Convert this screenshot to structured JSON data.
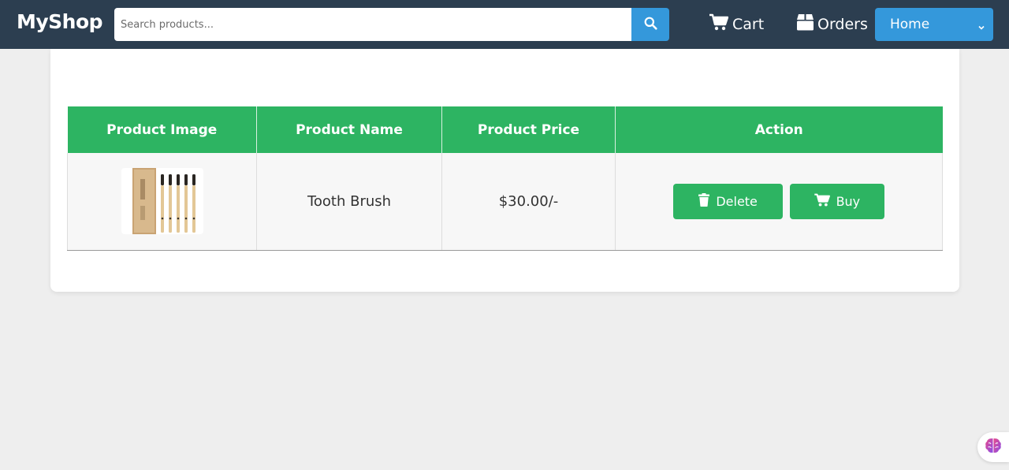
{
  "navbar": {
    "brand": "MyShop",
    "search": {
      "placeholder": "Search products...",
      "value": ""
    },
    "links": [
      {
        "label": "Cart",
        "icon": "cart-icon"
      },
      {
        "label": "Orders",
        "icon": "box-icon"
      }
    ],
    "select": {
      "selected": "Home"
    }
  },
  "table": {
    "headers": [
      "Product Image",
      "Product Name",
      "Product Price",
      "Action"
    ],
    "rows": [
      {
        "image_alt": "Tooth Brush",
        "name": "Tooth Brush",
        "price": "$30.00/-"
      }
    ],
    "actions": {
      "delete_label": "Delete",
      "buy_label": "Buy"
    }
  },
  "colors": {
    "navbar_bg": "#2c3e50",
    "accent_blue": "#3498db",
    "table_green": "#2db462"
  }
}
